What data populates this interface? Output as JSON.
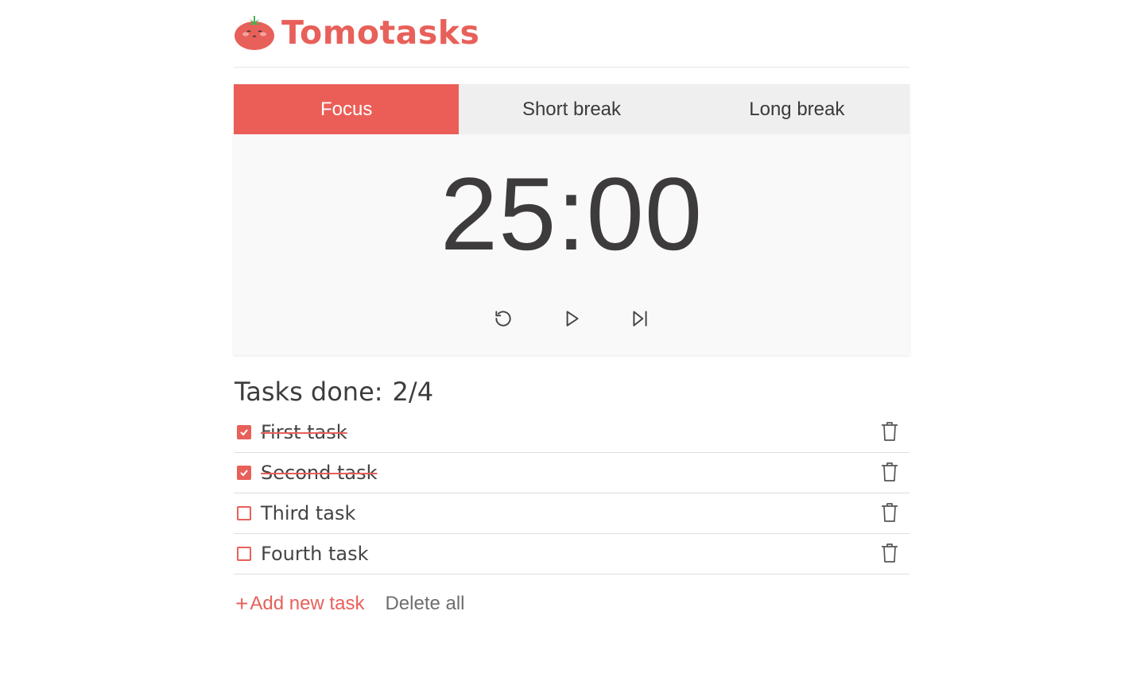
{
  "app": {
    "title": "Tomotasks",
    "logo_icon": "tomato-icon",
    "accent_color": "#eb5e57"
  },
  "timer": {
    "tabs": [
      {
        "label": "Focus",
        "active": true
      },
      {
        "label": "Short break",
        "active": false
      },
      {
        "label": "Long break",
        "active": false
      }
    ],
    "time": "25:00",
    "controls": [
      "reset-icon",
      "play-icon",
      "skip-icon"
    ]
  },
  "tasks": {
    "heading": "Tasks done:",
    "count": "2/4",
    "items": [
      {
        "label": "First task",
        "done": true
      },
      {
        "label": "Second task",
        "done": true
      },
      {
        "label": "Third task",
        "done": false
      },
      {
        "label": "Fourth task",
        "done": false
      }
    ],
    "add_label": "Add new task",
    "delete_all_label": "Delete all"
  }
}
